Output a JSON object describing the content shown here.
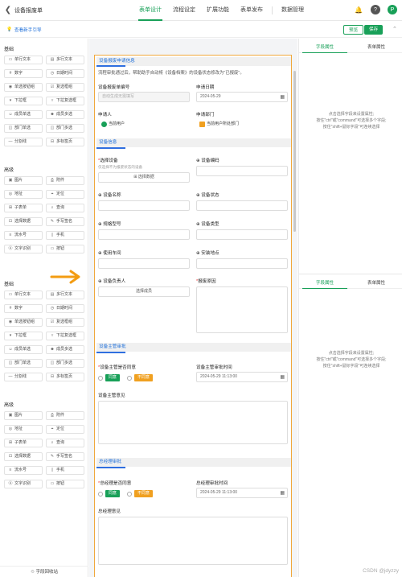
{
  "header": {
    "back_icon": "chevron-left-icon",
    "title": "设备报废单",
    "tabs": [
      "表单设计",
      "流程设定",
      "扩展功能",
      "表单发布"
    ],
    "extra_tab": "数据管理",
    "active_tab": 0
  },
  "subbar": {
    "guide_label": "查看新手引导",
    "preview_label": "预览",
    "save_label": "保存"
  },
  "palette": {
    "groups": [
      {
        "title": "基础",
        "items": [
          "单行文本",
          "多行文本",
          "数字",
          "日期时间",
          "单选按钮组",
          "复选框组",
          "下拉框",
          "下拉复选框",
          "成员单选",
          "成员多选",
          "部门单选",
          "部门多选",
          "分割线",
          "多标签页"
        ]
      },
      {
        "title": "高级",
        "items": [
          "图片",
          "附件",
          "地址",
          "定位",
          "子表单",
          "查询",
          "选择数据",
          "手写签名",
          "流水号",
          "手机",
          "文字识别",
          "按钮"
        ]
      },
      {
        "title": "基础",
        "items": [
          "单行文本",
          "多行文本",
          "数字",
          "日期时间",
          "单选按钮组",
          "复选框组",
          "下拉框",
          "下拉复选框",
          "成员单选",
          "成员多选",
          "部门单选",
          "部门多选",
          "分割线",
          "多标签页"
        ]
      },
      {
        "title": "高级",
        "items": [
          "图片",
          "附件",
          "地址",
          "定位",
          "子表单",
          "查询",
          "选择数据",
          "手写签名",
          "流水号",
          "手机",
          "文字识别",
          "按钮"
        ]
      }
    ],
    "recycle_label": "字段回收站"
  },
  "form": {
    "section1": {
      "title": "设备报废申请信息",
      "desc": "流程审批通过后，帮助助手自动将《设备档案》的设备状态修改为\"已报废\"。",
      "number_label": "设备报废单编号",
      "number_placeholder": "自动生成无需填写",
      "date_label": "申请日期",
      "date_value": "2024-05-29",
      "applicant_label": "申请人",
      "applicant_value": "当前用户",
      "dept_label": "申请部门",
      "dept_value": "当前用户所处部门"
    },
    "section2": {
      "title": "设备信息",
      "select_label": "选择设备",
      "select_hint": "仅选择不为报废状态的设备",
      "select_btn": "选择数据",
      "code_label": "设备编码",
      "name_label": "设备名称",
      "status_label": "设备状态",
      "model_label": "规格型号",
      "type_label": "设备类型",
      "workshop_label": "使用车间",
      "location_label": "安装地点",
      "owner_label": "设备负责人",
      "owner_btn": "选择成员",
      "reason_label": "报废原因"
    },
    "section3": {
      "title": "设备主管审批",
      "agree_label": "设备主管是否同意",
      "yes": "同意",
      "no": "不同意",
      "time_label": "设备主管审批时间",
      "time_value": "2024-05-29 11:13:00",
      "opinion_label": "设备主管意见"
    },
    "section4": {
      "title": "总经理审批",
      "agree_label": "总经理是否同意",
      "yes": "同意",
      "no": "不同意",
      "time_label": "总经理审批时间",
      "time_value": "2024-05-29 11:13:00",
      "opinion_label": "总经理意见"
    }
  },
  "right_panel": {
    "tab_field": "字段属性",
    "tab_form": "表单属性",
    "hint_line1": "点击选择字段来设置属性;",
    "hint_line2": "按住\"ctrl\"或\"command\"可选择多个字段;",
    "hint_line3": "按住\"shift+鼠标字段\"可连续选择"
  },
  "colors": {
    "accent": "#18a058",
    "section_blue": "#1e6fd9",
    "selection_border": "#f0a83c",
    "arrow": "#f39c12"
  },
  "watermark": "CSDN @jdyzzy"
}
